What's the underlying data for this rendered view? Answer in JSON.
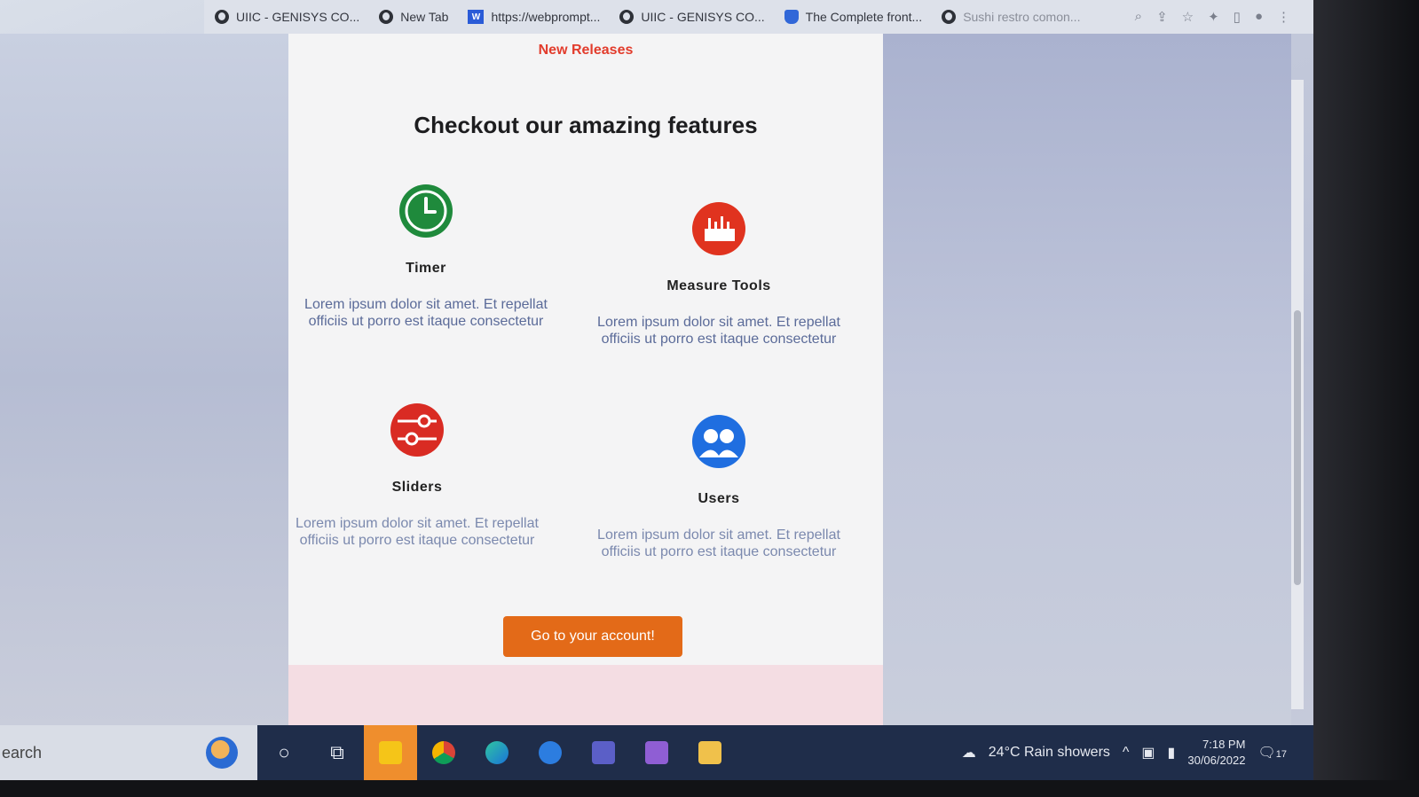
{
  "bookmarks": [
    {
      "label": "UIIC - GENISYS CO...",
      "icon": "globe-icon"
    },
    {
      "label": "New Tab",
      "icon": "globe-icon"
    },
    {
      "label": "https://webprompt...",
      "icon": "w-badge-icon"
    },
    {
      "label": "UIIC - GENISYS CO...",
      "icon": "globe-icon"
    },
    {
      "label": "The Complete front...",
      "icon": "user-badge-icon"
    },
    {
      "label": "Sushi restro comon...",
      "icon": "globe-icon"
    }
  ],
  "page": {
    "new_releases": "New Releases",
    "title": "Checkout our amazing features",
    "features": [
      {
        "name": "Timer",
        "desc": "Lorem ipsum dolor sit amet. Et repellat officiis ut porro est itaque consectetur",
        "icon": "clock-icon",
        "color": "#1f8a3c"
      },
      {
        "name": "Measure Tools",
        "desc": "Lorem ipsum dolor sit amet. Et repellat officiis ut porro est itaque consectetur",
        "icon": "measure-icon",
        "color": "#e0331f"
      },
      {
        "name": "Sliders",
        "desc": "Lorem ipsum dolor sit amet. Et repellat officiis ut porro est itaque consectetur",
        "icon": "sliders-icon",
        "color": "#d92b23"
      },
      {
        "name": "Users",
        "desc": "Lorem ipsum dolor sit amet. Et repellat officiis ut porro est itaque consectetur",
        "icon": "users-icon",
        "color": "#1f6ee0"
      }
    ],
    "cta_label": "Go to your account!",
    "cta_color": "#e36a18"
  },
  "taskbar": {
    "search_text": "earch",
    "weather": "24°C  Rain showers",
    "time": "7:18 PM",
    "date": "30/06/2022",
    "notifications": "17"
  }
}
